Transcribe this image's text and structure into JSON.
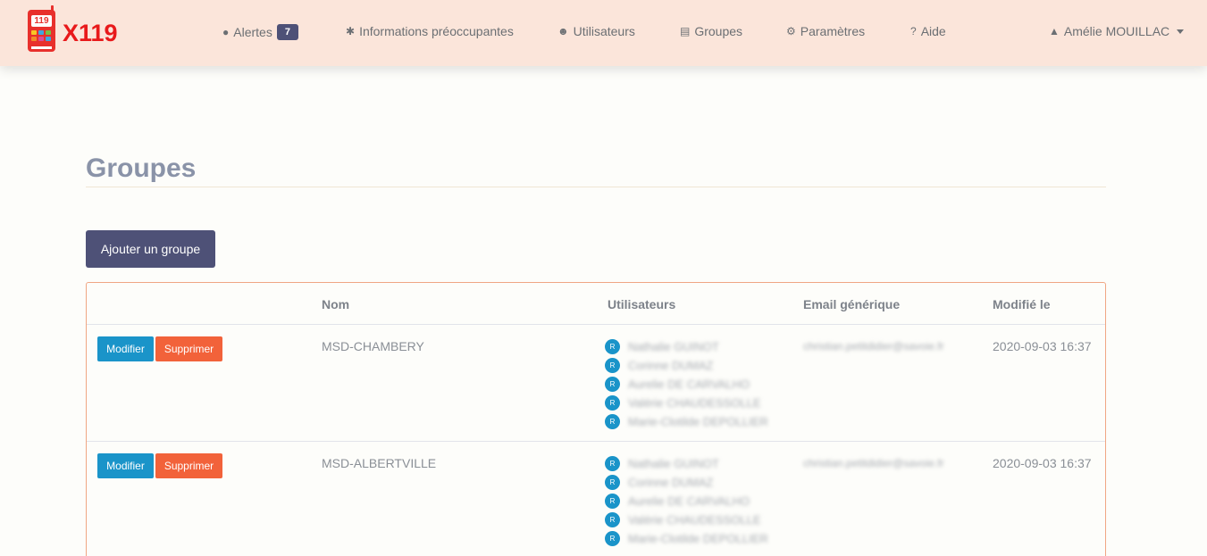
{
  "brand": {
    "name": "X119",
    "logo_screen_text": "119"
  },
  "nav": {
    "items": [
      {
        "label": "Alertes",
        "icon": "exclamation-circle-icon",
        "badge": "7"
      },
      {
        "label": "Informations préoccupantes",
        "icon": "asterisk-icon"
      },
      {
        "label": "Utilisateurs",
        "icon": "users-icon"
      },
      {
        "label": "Groupes",
        "icon": "map-icon"
      },
      {
        "label": "Paramètres",
        "icon": "cogs-icon"
      },
      {
        "label": "Aide",
        "icon": "question-circle-icon"
      }
    ],
    "user": {
      "label": "Amélie MOUILLAC",
      "icon": "user-icon"
    }
  },
  "page": {
    "title": "Groupes",
    "add_button": "Ajouter un groupe"
  },
  "table": {
    "headers": [
      "",
      "Nom",
      "Utilisateurs",
      "Email générique",
      "Modifié le"
    ],
    "edit_label": "Modifier",
    "delete_label": "Supprimer",
    "rows": [
      {
        "name": "MSD-CHAMBERY",
        "users": [
          {
            "badge": "R",
            "name": "Nathalie GUINOT"
          },
          {
            "badge": "R",
            "name": "Corinne DUMAZ"
          },
          {
            "badge": "R",
            "name": "Aurelie DE CARVALHO"
          },
          {
            "badge": "R",
            "name": "Valérie CHAUDESSOLLE"
          },
          {
            "badge": "R",
            "name": "Marie-Clotilde DEPOLLIER"
          }
        ],
        "email": "christian.petitdidier@savoie.fr",
        "modified": "2020-09-03 16:37"
      },
      {
        "name": "MSD-ALBERTVILLE",
        "users": [
          {
            "badge": "R",
            "name": "Nathalie GUINOT"
          },
          {
            "badge": "R",
            "name": "Corinne DUMAZ"
          },
          {
            "badge": "R",
            "name": "Aurelie DE CARVALHO"
          },
          {
            "badge": "R",
            "name": "Valérie CHAUDESSOLLE"
          },
          {
            "badge": "R",
            "name": "Marie-Clotilde DEPOLLIER"
          }
        ],
        "email": "christian.petitdidier@savoie.fr",
        "modified": "2020-09-03 16:37"
      }
    ]
  },
  "colors": {
    "navbar_bg": "#fbe5da",
    "primary": "#4e5177",
    "edit": "#1a94c9",
    "delete": "#f2623a",
    "brand_red": "#e8191b"
  }
}
